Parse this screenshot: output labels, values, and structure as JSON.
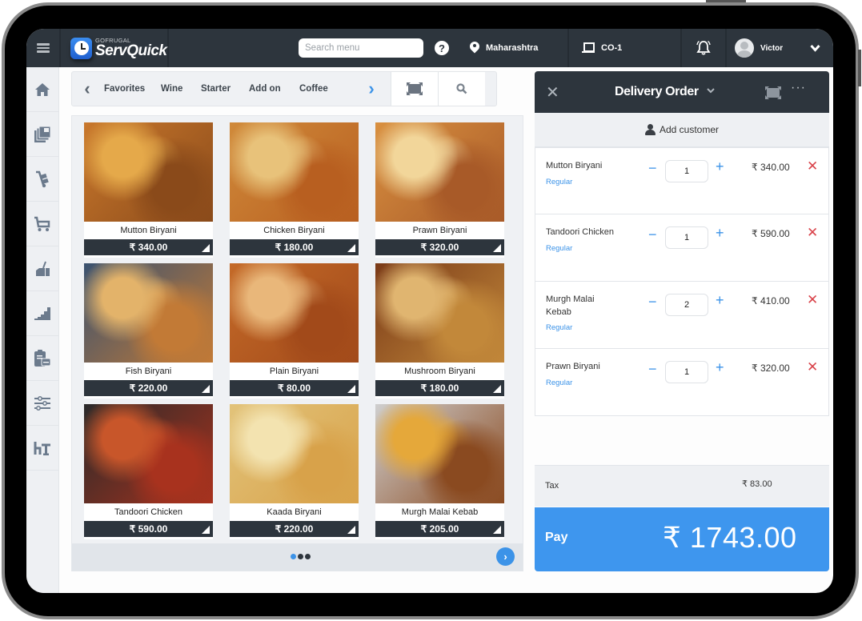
{
  "brand": {
    "company": "GOFRUGAL",
    "product": "ServQuick"
  },
  "topbar": {
    "search_placeholder": "Search menu",
    "help_glyph": "?",
    "location": "Maharashtra",
    "counter": "CO-1",
    "bell_glyph": "🔔",
    "user": "Victor",
    "user_chevron": "❤"
  },
  "sidebar": {
    "items": [
      {
        "icon": "home-icon",
        "glyph": "⌂"
      },
      {
        "icon": "catalog-icon",
        "glyph": "▤"
      },
      {
        "icon": "hand-truck-icon",
        "glyph": "⛟"
      },
      {
        "icon": "cart-icon",
        "glyph": "🛒"
      },
      {
        "icon": "cleaning-icon",
        "glyph": "⌧"
      },
      {
        "icon": "bar-chart-icon",
        "glyph": "▟"
      },
      {
        "icon": "clipboard-icon",
        "glyph": "▣"
      },
      {
        "icon": "sliders-icon",
        "glyph": "☰"
      },
      {
        "icon": "table-icon",
        "glyph": "⊤"
      }
    ]
  },
  "categories": {
    "prev_glyph": "‹",
    "next_glyph": "›",
    "tabs": [
      "Favorites",
      "Wine",
      "Starter",
      "Add on",
      "Coffee"
    ],
    "search_glyph": "🔍"
  },
  "menu_items": [
    {
      "name": "Mutton Biryani",
      "price": "₹ 340.00",
      "colors": [
        "#c9782c",
        "#8a4a1a",
        "#e5a94a"
      ]
    },
    {
      "name": "Chicken Biryani",
      "price": "₹ 180.00",
      "colors": [
        "#d08a3a",
        "#b85f20",
        "#e8c27a"
      ]
    },
    {
      "name": "Prawn Biryani",
      "price": "₹ 320.00",
      "colors": [
        "#d99040",
        "#a85a28",
        "#f2d69a"
      ]
    },
    {
      "name": "Fish Biryani",
      "price": "₹ 220.00",
      "colors": [
        "#3a5270",
        "#c27a36",
        "#e3b36a"
      ]
    },
    {
      "name": "Plain Biryani",
      "price": "₹ 80.00",
      "colors": [
        "#c46a28",
        "#a24a1a",
        "#e9b77a"
      ]
    },
    {
      "name": "Mushroom Biryani",
      "price": "₹ 180.00",
      "colors": [
        "#7a3a18",
        "#c2883a",
        "#e0b570"
      ]
    },
    {
      "name": "Tandoori Chicken",
      "price": "₹ 590.00",
      "colors": [
        "#2a2a2a",
        "#a8321e",
        "#c8562a"
      ]
    },
    {
      "name": "Kaada Biryani",
      "price": "₹ 220.00",
      "colors": [
        "#e2c37a",
        "#d8a24a",
        "#f3e3b0"
      ]
    },
    {
      "name": "Murgh Malai Kebab",
      "price": "₹ 205.00",
      "colors": [
        "#cfcfcf",
        "#8a4a20",
        "#e5a83a"
      ]
    }
  ],
  "pager": {
    "pages": 3,
    "current": 1,
    "next_glyph": "›"
  },
  "order": {
    "title": "Delivery Order",
    "title_chevron": "⌄",
    "close_glyph": "✕",
    "more_glyph": "···",
    "add_customer": "Add customer",
    "items": [
      {
        "name": "Mutton Biryani",
        "variant": "Regular",
        "qty": "1",
        "price": "₹ 340.00"
      },
      {
        "name": "Tandoori Chicken",
        "variant": "Regular",
        "qty": "1",
        "price": "₹ 590.00"
      },
      {
        "name": "Murgh Malai Kebab",
        "variant": "Regular",
        "qty": "2",
        "price": "₹ 410.00"
      },
      {
        "name": "Prawn Biryani",
        "variant": "Regular",
        "qty": "1",
        "price": "₹ 320.00"
      }
    ],
    "minus_glyph": "−",
    "plus_glyph": "+",
    "remove_glyph": "✕",
    "tax_label": "Tax",
    "tax_value": "₹ 83.00",
    "pay_label": "Pay",
    "pay_amount": "₹ 1743.00"
  }
}
